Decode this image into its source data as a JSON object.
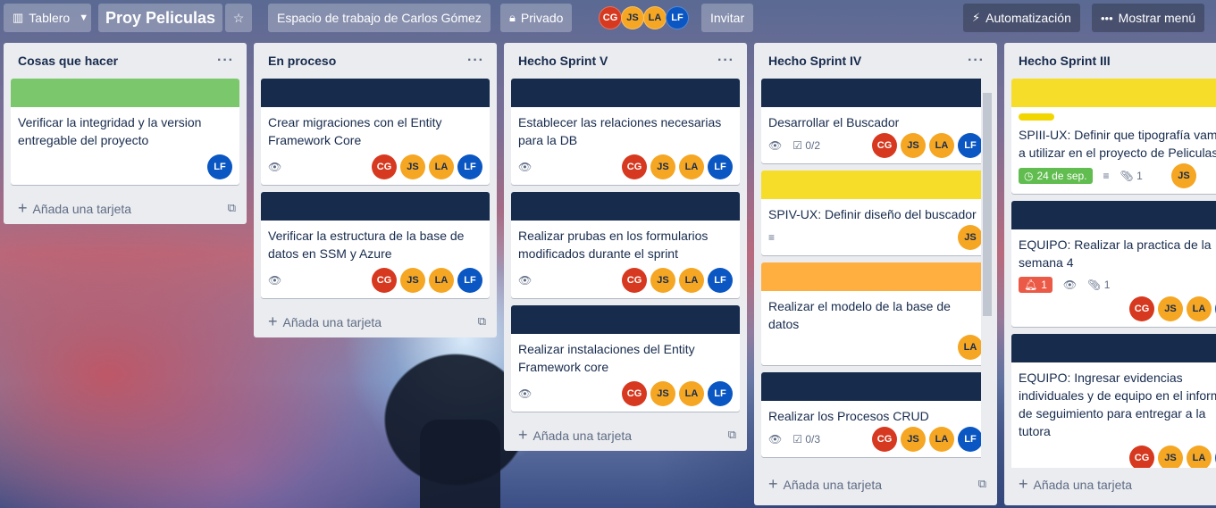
{
  "header": {
    "board_view": "Tablero",
    "board_title": "Proy Peliculas",
    "workspace": "Espacio de trabajo de Carlos Gómez",
    "privacy": "Privado",
    "members": [
      "CG",
      "JS",
      "LA",
      "LF"
    ],
    "invite": "Invitar",
    "automation": "Automatización",
    "menu": "Mostrar menú"
  },
  "add_card_label": "Añada una tarjeta",
  "lists": [
    {
      "title": "Cosas que hacer",
      "cards": [
        {
          "cover": "#7bc86c",
          "title": "Verificar la integridad y la version entregable del proyecto",
          "members": [
            "LF"
          ]
        }
      ]
    },
    {
      "title": "En proceso",
      "cards": [
        {
          "cover": "#172b4d",
          "title": "Crear migraciones con el Entity Framework Core",
          "members": [
            "CG",
            "JS",
            "LA",
            "LF"
          ]
        },
        {
          "cover": "#172b4d",
          "title": "Verificar la estructura de la base de datos en SSM y Azure",
          "members": [
            "CG",
            "JS",
            "LA",
            "LF"
          ]
        }
      ]
    },
    {
      "title": "Hecho Sprint V",
      "cards": [
        {
          "cover": "#172b4d",
          "title": "Establecer las relaciones necesarias para la DB",
          "members": [
            "CG",
            "JS",
            "LA",
            "LF"
          ]
        },
        {
          "cover": "#172b4d",
          "title": "Realizar prubas en los formularios modificados durante el sprint",
          "members": [
            "CG",
            "JS",
            "LA",
            "LF"
          ]
        },
        {
          "cover": "#172b4d",
          "title": "Realizar instalaciones del Entity Framework core",
          "members": [
            "CG",
            "JS",
            "LA",
            "LF"
          ]
        }
      ]
    },
    {
      "title": "Hecho Sprint IV",
      "cards": [
        {
          "cover": "#172b4d",
          "title": "Desarrollar el Buscador",
          "checklist": "0/2",
          "members": [
            "CG",
            "JS",
            "LA",
            "LF"
          ]
        },
        {
          "cover": "#f5dd29",
          "title": "SPIV-UX: Definir diseño del buscador",
          "members": [
            "JS"
          ]
        },
        {
          "cover": "#ffaf3f",
          "title": "Realizar el modelo de la base de datos",
          "members": [
            "LA"
          ]
        },
        {
          "cover": "#172b4d",
          "title": "Realizar los Procesos CRUD",
          "checklist": "0/3",
          "members": [
            "CG",
            "JS",
            "LA",
            "LF"
          ]
        }
      ]
    },
    {
      "title": "Hecho Sprint III",
      "cards": [
        {
          "cover": "#f5dd29",
          "title": "SPIII-UX: Definir que tipografía vamos a utilizar en el proyecto de Peliculas",
          "due": "24 de sep.",
          "attachments": "1",
          "members": [
            "JS"
          ]
        },
        {
          "cover": "#172b4d",
          "title": "EQUIPO: Realizar la practica de la semana 4",
          "notifications": "1",
          "attachments": "1",
          "members": [
            "CG",
            "JS",
            "LA",
            "LF"
          ]
        },
        {
          "cover": "#172b4d",
          "title": "EQUIPO: Ingresar evidencias individuales y de equipo en el informe de seguimiento para entregar a la tutora",
          "members": [
            "CG",
            "JS",
            "LA",
            "LF"
          ]
        }
      ]
    }
  ],
  "colors": {
    "cover_dark": "#172b4d",
    "cover_green": "#7bc86c",
    "cover_yellow": "#f5dd29",
    "cover_orange": "#ffaf3f",
    "avatar_cg": "#d6391f",
    "avatar_js": "#f5a623",
    "avatar_la": "#f5a623",
    "avatar_lf": "#0a56c2"
  }
}
